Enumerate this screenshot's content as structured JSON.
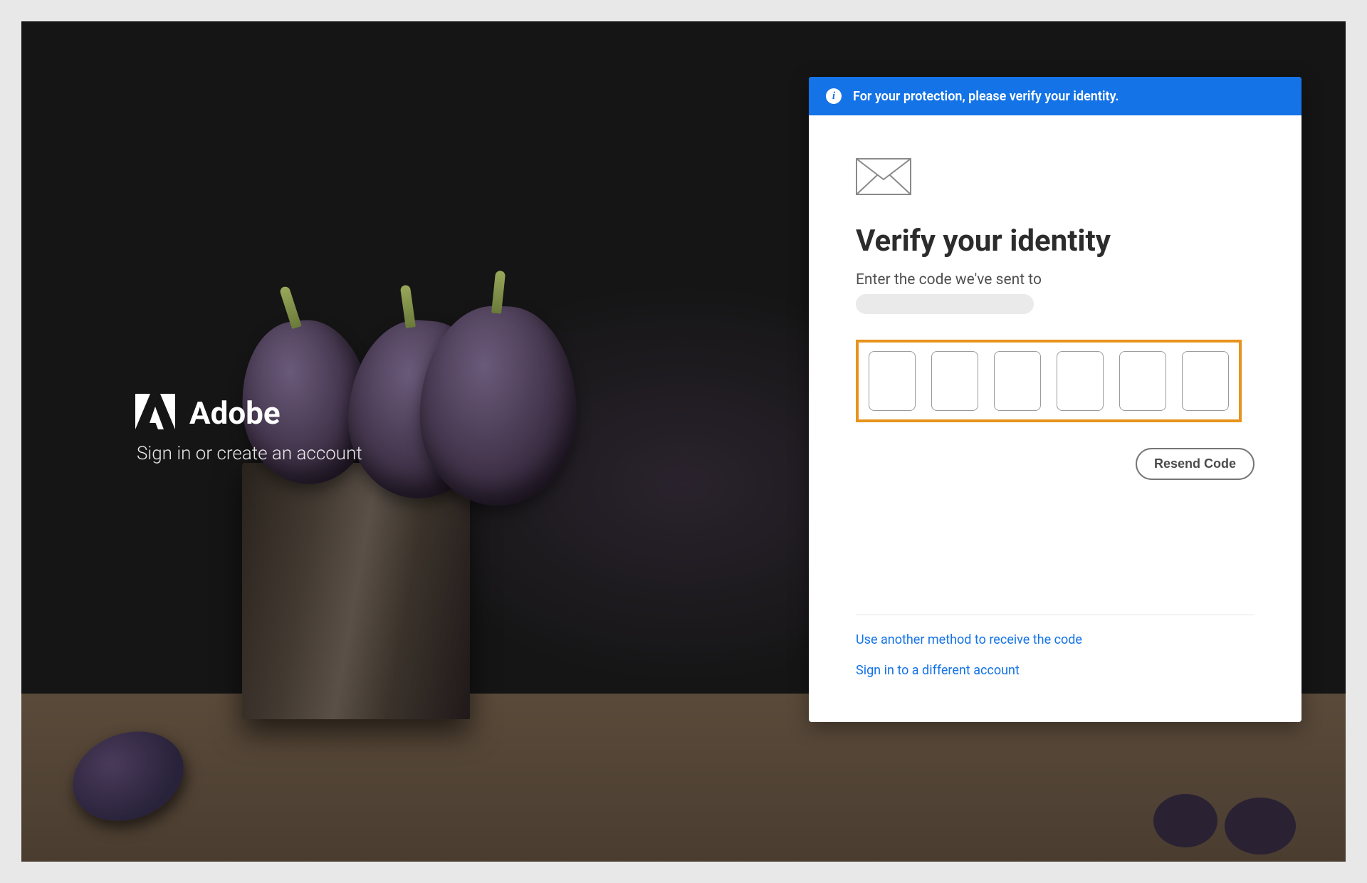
{
  "brand": {
    "name": "Adobe",
    "subtitle": "Sign in or create an account"
  },
  "banner": {
    "text": "For your protection, please verify your identity."
  },
  "card": {
    "title": "Verify your identity",
    "subtitle": "Enter the code we've sent to",
    "resend_label": "Resend Code",
    "link_another_method": "Use another method to receive the code",
    "link_different_account": "Sign in to a different account",
    "code_digits": 6,
    "highlight_color": "#e8931c",
    "banner_color": "#1473e6"
  }
}
